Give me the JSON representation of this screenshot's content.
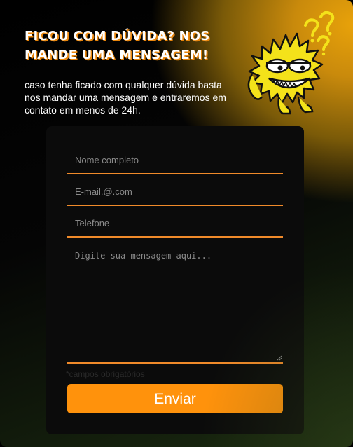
{
  "header": {
    "title": "FICOU COM DÚVIDA? NOS MANDE UMA MENSAGEM!",
    "subtitle": "caso tenha ficado com qualquer dúvida basta nos mandar uma mensagem e entraremos em contato em menos de 24h."
  },
  "mascot": {
    "icon": "confused-yellow-monster-icon",
    "marks": "??"
  },
  "form": {
    "name_placeholder": "Nome completo",
    "email_placeholder": "E-mail.@.com",
    "phone_placeholder": "Telefone",
    "message_placeholder": "Digite sua mensagem aqui...",
    "required_note": "*campos obrigatórios",
    "submit_label": "Enviar"
  },
  "colors": {
    "accent": "#ff920c",
    "underline": "#f08a2a",
    "title_shadow": "#e8850c",
    "mascot_body": "#f4e21a"
  }
}
